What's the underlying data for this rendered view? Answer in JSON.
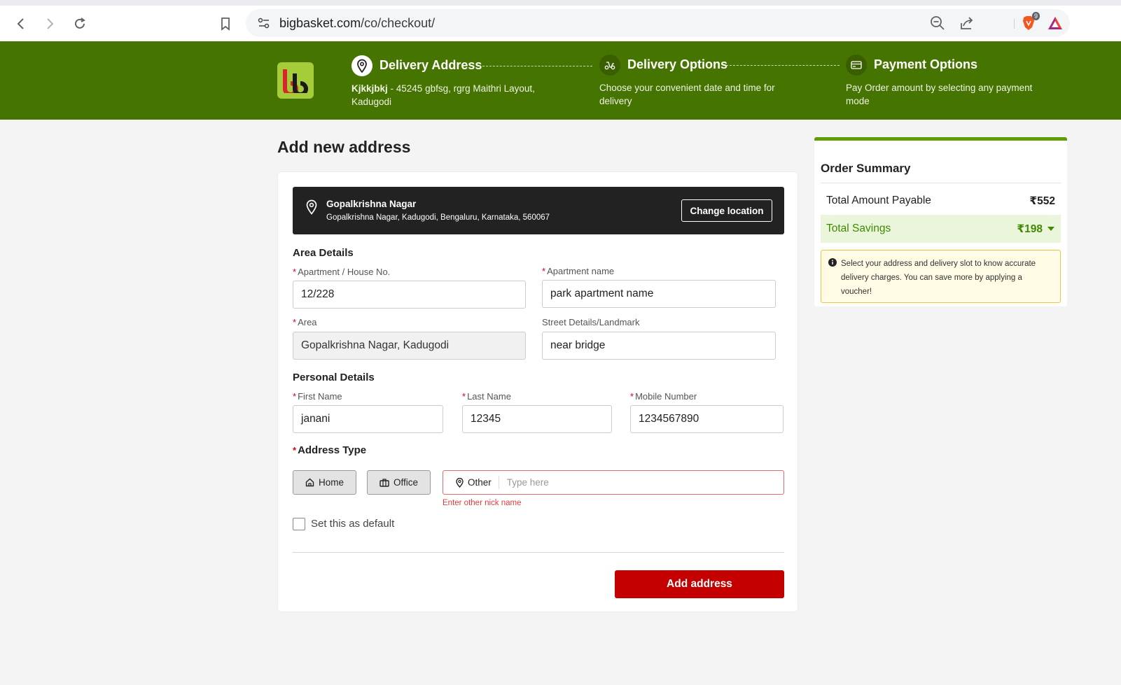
{
  "browser": {
    "url_host": "bigbasket.com",
    "url_path": "/co/checkout/",
    "extension_badge": "9"
  },
  "header": {
    "steps": [
      {
        "title": "Delivery Address",
        "desc_bold": "Kjkkjbkj",
        "desc": " - 45245 gbfsg, rgrg Maithri Layout, Kadugodi"
      },
      {
        "title": "Delivery Options",
        "desc": "Choose your convenient date and time for delivery"
      },
      {
        "title": "Payment Options",
        "desc": "Pay Order amount by selecting any payment mode"
      }
    ]
  },
  "page_title": "Add new address",
  "location": {
    "name": "Gopalkrishna Nagar",
    "address": "Gopalkrishna Nagar, Kadugodi, Bengaluru, Karnataka, 560067",
    "change_label": "Change location"
  },
  "area": {
    "section": "Area Details",
    "house_label": "Apartment / House No.",
    "house_value": "12/228",
    "apartment_label": "Apartment name",
    "apartment_value": "park apartment name",
    "area_label": "Area",
    "area_value": "Gopalkrishna Nagar, Kadugodi",
    "street_label": "Street Details/Landmark",
    "street_value": "near bridge"
  },
  "personal": {
    "section": "Personal Details",
    "first_label": "First Name",
    "first_value": "janani",
    "last_label": "Last Name",
    "last_value": "12345",
    "mobile_label": "Mobile Number",
    "mobile_value": "1234567890"
  },
  "address_type": {
    "label": "Address Type",
    "home": "Home",
    "office": "Office",
    "other": "Other",
    "other_placeholder": "Type here",
    "error": "Enter other nick name"
  },
  "default_label": "Set this as default",
  "add_button": "Add address",
  "summary": {
    "title": "Order Summary",
    "total_label": "Total Amount Payable",
    "total_value": "₹552",
    "savings_label": "Total Savings",
    "savings_value": "₹198",
    "note": "Select your address and delivery slot to know accurate delivery charges. You can save more by applying a voucher!"
  },
  "colors": {
    "header_green": "#467400",
    "accent_red": "#c50000",
    "savings_green": "#3f8a00"
  }
}
